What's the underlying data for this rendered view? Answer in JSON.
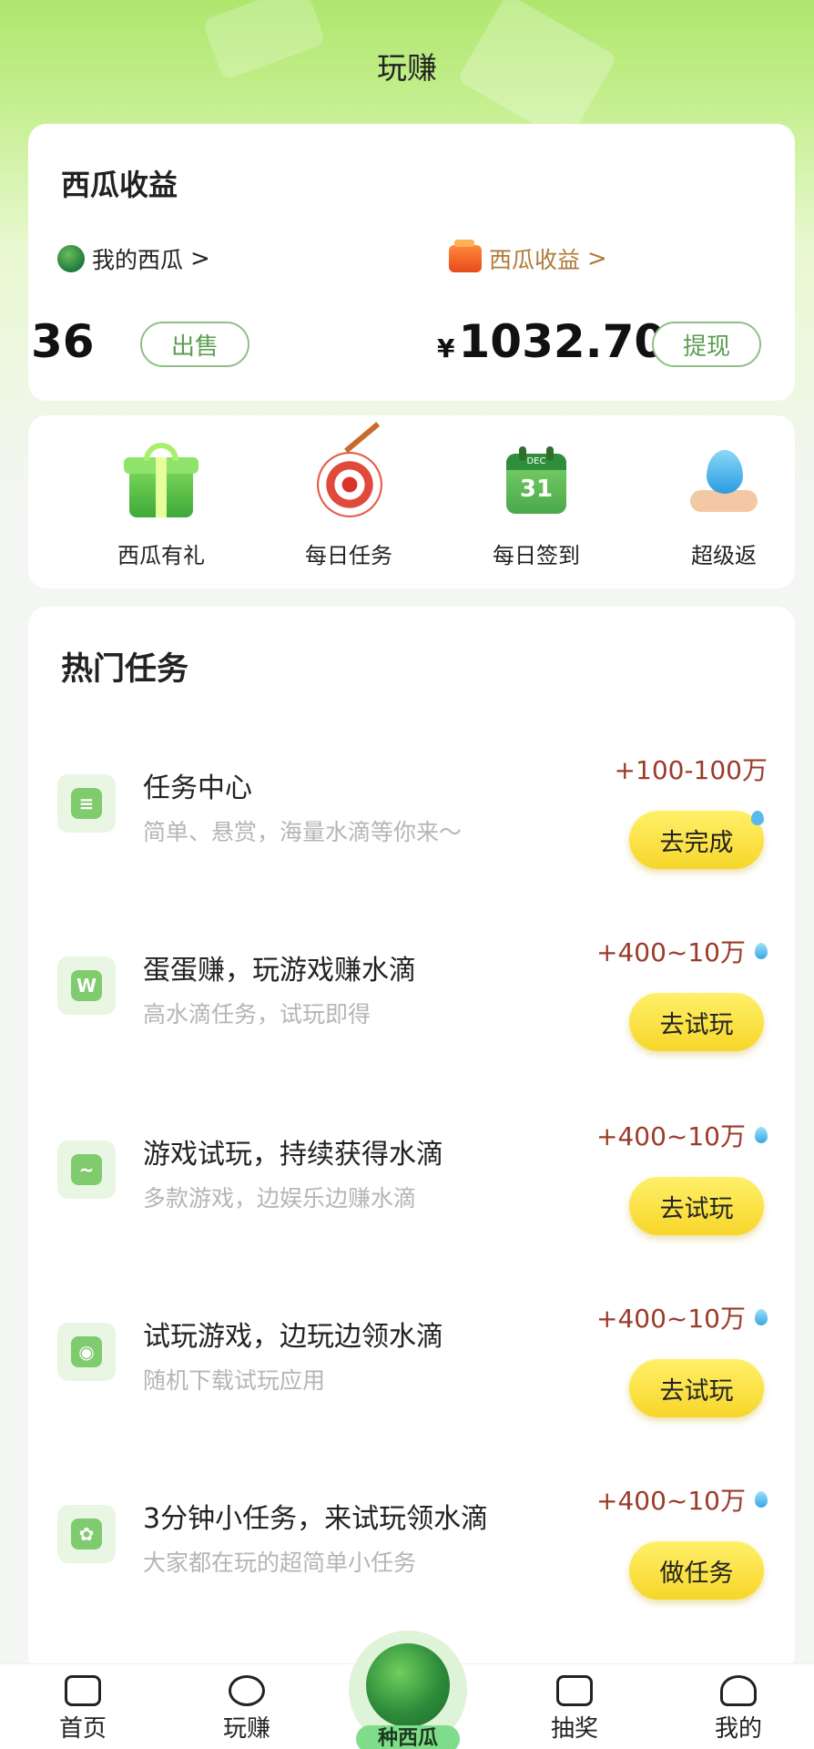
{
  "header": {
    "title": "玩赚"
  },
  "earnings": {
    "title": "西瓜收益",
    "my_melons_label": "我的西瓜",
    "melon_income_label": "西瓜收益",
    "chevron": ">",
    "melon_count": "36",
    "sell_label": "出售",
    "currency_symbol": "¥",
    "income_amount": "1032.70",
    "withdraw_label": "提现"
  },
  "menu": {
    "items": [
      {
        "label": "西瓜有礼",
        "icon": "gift-icon"
      },
      {
        "label": "每日任务",
        "icon": "target-icon"
      },
      {
        "label": "每日签到",
        "icon": "calendar-icon",
        "badge_month": "DEC",
        "badge_day": "31"
      },
      {
        "label": "超级返",
        "icon": "water-hand-icon"
      }
    ]
  },
  "tasks": {
    "title": "热门任务",
    "items": [
      {
        "name": "任务中心",
        "desc": "简单、悬赏，海量水滴等你来～",
        "reward": "+100-100万",
        "button": "去完成",
        "icon": "clipboard-icon"
      },
      {
        "name": "蛋蛋赚，玩游戏赚水滴",
        "desc": "高水滴任务，试玩即得",
        "reward": "+400~10万",
        "button": "去试玩",
        "icon": "w-badge-icon"
      },
      {
        "name": "游戏试玩，持续获得水滴",
        "desc": "多款游戏，边娱乐边赚水滴",
        "reward": "+400~10万",
        "button": "去试玩",
        "icon": "dolphin-icon"
      },
      {
        "name": "试玩游戏，边玩边领水滴",
        "desc": "随机下载试玩应用",
        "reward": "+400~10万",
        "button": "去试玩",
        "icon": "gamepad-icon"
      },
      {
        "name": "3分钟小任务，来试玩领水滴",
        "desc": "大家都在玩的超简单小任务",
        "reward": "+400~10万",
        "button": "做任务",
        "icon": "leaf-icon"
      }
    ]
  },
  "bottom_nav": {
    "items": [
      {
        "label": "首页",
        "icon": "home-icon"
      },
      {
        "label": "玩赚",
        "icon": "money-bag-icon"
      },
      {
        "label": "种西瓜",
        "icon": "watermelon-icon"
      },
      {
        "label": "抽奖",
        "icon": "gift-box-icon"
      },
      {
        "label": "我的",
        "icon": "user-icon"
      }
    ]
  }
}
